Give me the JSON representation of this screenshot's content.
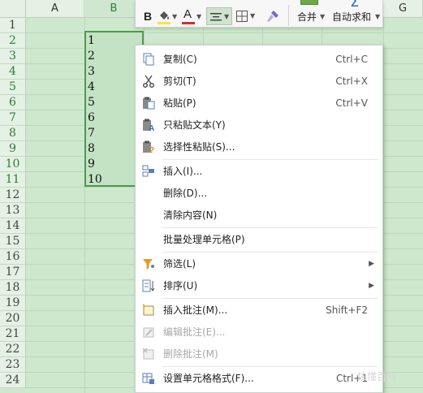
{
  "sheet": {
    "columns": [
      "A",
      "B",
      "G"
    ],
    "rows": [
      "1",
      "2",
      "3",
      "4",
      "5",
      "6",
      "7",
      "8",
      "9",
      "10",
      "11",
      "12",
      "13",
      "14",
      "15",
      "16",
      "17",
      "18",
      "19",
      "20",
      "21",
      "22",
      "23",
      "24"
    ],
    "cells_B": [
      "1",
      "2",
      "3",
      "4",
      "5",
      "6",
      "7",
      "8",
      "9",
      "10"
    ]
  },
  "toolbar": {
    "bold": "B",
    "font_color": "A",
    "merge": "合并",
    "autosum": "自动求和",
    "colors": {
      "highlight": "#f5e642",
      "font": "#d32f2f",
      "accent": "#4e9a4e"
    }
  },
  "menu": {
    "items": [
      {
        "label": "复制(C)",
        "shortcut": "Ctrl+C",
        "icon": "copy-icon"
      },
      {
        "label": "剪切(T)",
        "shortcut": "Ctrl+X",
        "icon": "scissors-icon"
      },
      {
        "label": "粘贴(P)",
        "shortcut": "Ctrl+V",
        "icon": "paste-icon"
      },
      {
        "label": "只粘贴文本(Y)",
        "shortcut": "",
        "icon": "paste-text-icon"
      },
      {
        "label": "选择性粘贴(S)...",
        "shortcut": "",
        "icon": "paste-special-icon"
      },
      {
        "label": "插入(I)...",
        "shortcut": "",
        "icon": "insert-icon"
      },
      {
        "label": "删除(D)...",
        "shortcut": "",
        "icon": ""
      },
      {
        "label": "清除内容(N)",
        "shortcut": "",
        "icon": ""
      },
      {
        "label": "批量处理单元格(P)",
        "shortcut": "",
        "icon": ""
      },
      {
        "label": "筛选(L)",
        "shortcut": "",
        "icon": "filter-icon"
      },
      {
        "label": "排序(U)",
        "shortcut": "",
        "icon": "sort-icon"
      },
      {
        "label": "插入批注(M)...",
        "shortcut": "Shift+F2",
        "icon": "insert-comment-icon"
      },
      {
        "label": "编辑批注(E)...",
        "shortcut": "",
        "icon": "edit-comment-icon"
      },
      {
        "label": "删除批注(M)",
        "shortcut": "",
        "icon": "delete-comment-icon"
      },
      {
        "label": "设置单元格格式(F)...",
        "shortcut": "Ctrl+1",
        "icon": "format-cells-icon"
      }
    ]
  },
  "watermark": "快懂百科"
}
